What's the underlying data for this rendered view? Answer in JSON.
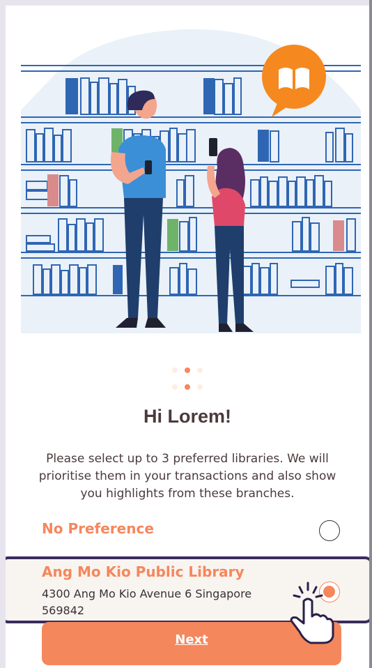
{
  "colors": {
    "accent": "#f5875c",
    "text": "#4b3a3c",
    "selection_border": "#3a2c5c"
  },
  "illustration": {
    "badge_icon": "open-book-icon"
  },
  "pager": {
    "rows": 2,
    "dots_per_row": 3,
    "active_index": 1
  },
  "greeting": {
    "title": "Hi Lorem!",
    "subtitle": "Please select up to 3 preferred libraries. We will prioritise them in your transactions and also show you highlights from these branches."
  },
  "options": [
    {
      "label": "No Preference",
      "selected": false
    },
    {
      "label": "Ang Mo Kio Public Library",
      "address_line1": "4300 Ang Mo Kio Avenue 6   Singapore",
      "address_line2": "569842",
      "selected": true
    }
  ],
  "next_button": {
    "label": "Next"
  }
}
